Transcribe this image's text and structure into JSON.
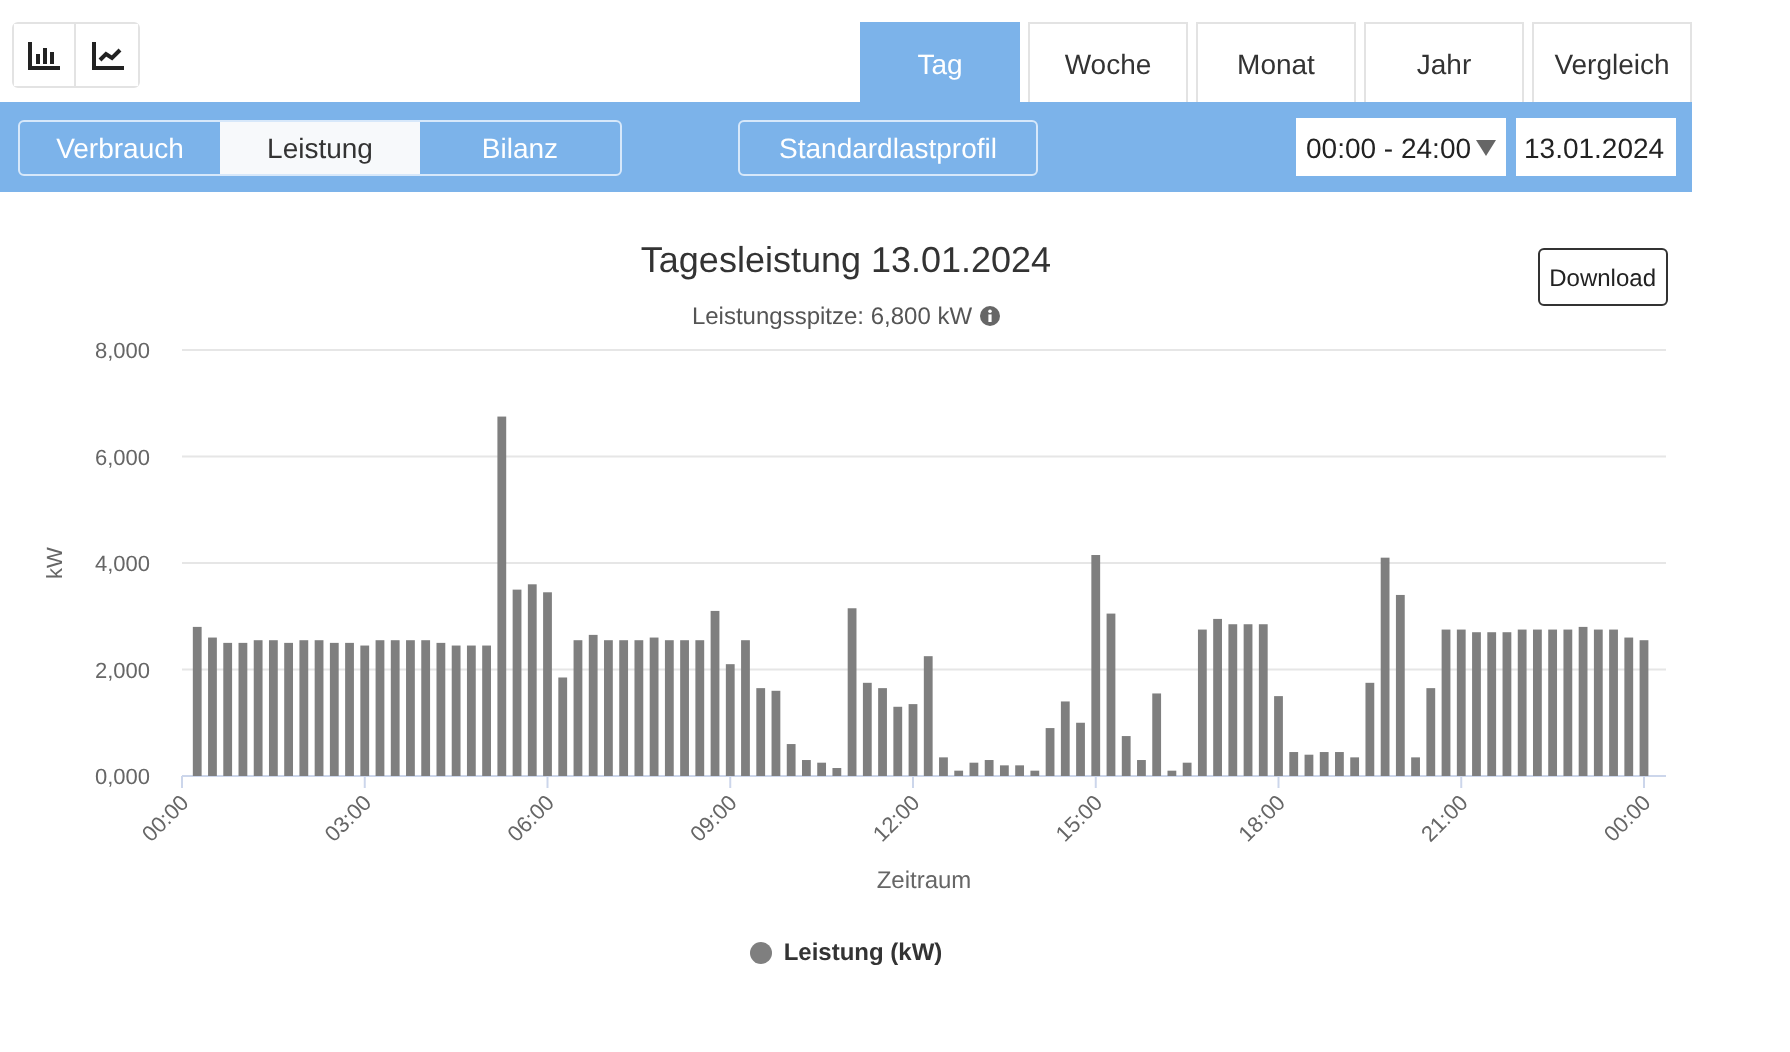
{
  "view_tabs": [
    {
      "label": "Tag",
      "selected": true
    },
    {
      "label": "Woche",
      "selected": false
    },
    {
      "label": "Monat",
      "selected": false
    },
    {
      "label": "Jahr",
      "selected": false
    },
    {
      "label": "Vergleich",
      "selected": false
    }
  ],
  "modes": [
    {
      "label": "Verbrauch",
      "selected": false
    },
    {
      "label": "Leistung",
      "selected": true
    },
    {
      "label": "Bilanz",
      "selected": false
    }
  ],
  "profile_button": "Standardlastprofil",
  "time_range": "00:00 - 24:00",
  "date": "13.01.2024",
  "chart": {
    "title": "Tagesleistung 13.01.2024",
    "subtitle": "Leistungsspitze: 6,800 kW",
    "download": "Download",
    "chart_data": {
      "type": "bar",
      "grid": "y",
      "xlabel": "Zeitraum",
      "ylabel": "kW",
      "xlim": [
        0,
        24
      ],
      "ylim": [
        0,
        8000
      ],
      "yticks": [
        {
          "value": 0,
          "label": "0,000"
        },
        {
          "value": 2000,
          "label": "2,000"
        },
        {
          "value": 4000,
          "label": "4,000"
        },
        {
          "value": 6000,
          "label": "6,000"
        },
        {
          "value": 8000,
          "label": "8,000"
        }
      ],
      "xticks": [
        {
          "value": 0,
          "label": "00:00"
        },
        {
          "value": 3,
          "label": "03:00"
        },
        {
          "value": 6,
          "label": "06:00"
        },
        {
          "value": 9,
          "label": "09:00"
        },
        {
          "value": 12,
          "label": "12:00"
        },
        {
          "value": 15,
          "label": "15:00"
        },
        {
          "value": 18,
          "label": "18:00"
        },
        {
          "value": 21,
          "label": "21:00"
        },
        {
          "value": 24,
          "label": "00:00"
        }
      ],
      "x": [
        0.25,
        0.5,
        0.75,
        1,
        1.25,
        1.5,
        1.75,
        2,
        2.25,
        2.5,
        2.75,
        3,
        3.25,
        3.5,
        3.75,
        4,
        4.25,
        4.5,
        4.75,
        5,
        5.25,
        5.5,
        5.75,
        6,
        6.25,
        6.5,
        6.75,
        7,
        7.25,
        7.5,
        7.75,
        8,
        8.25,
        8.5,
        8.75,
        9,
        9.25,
        9.5,
        9.75,
        10,
        10.25,
        10.5,
        10.75,
        11,
        11.25,
        11.5,
        11.75,
        12,
        12.25,
        12.5,
        12.75,
        13,
        13.25,
        13.5,
        13.75,
        14,
        14.25,
        14.5,
        14.75,
        15,
        15.25,
        15.5,
        15.75,
        16,
        16.25,
        16.5,
        16.75,
        17,
        17.25,
        17.5,
        17.75,
        18,
        18.25,
        18.5,
        18.75,
        19,
        19.25,
        19.5,
        19.75,
        20,
        20.25,
        20.5,
        20.75,
        21,
        21.25,
        21.5,
        21.75,
        22,
        22.25,
        22.5,
        22.75,
        23,
        23.25,
        23.5,
        23.75,
        24
      ],
      "series": [
        {
          "name": "Leistung (kW)",
          "color": "#7f7f7f",
          "values": [
            2800,
            2600,
            2500,
            2500,
            2550,
            2550,
            2500,
            2550,
            2550,
            2500,
            2500,
            2450,
            2550,
            2550,
            2550,
            2550,
            2500,
            2450,
            2450,
            2450,
            6750,
            3500,
            3600,
            3450,
            1850,
            2550,
            2650,
            2550,
            2550,
            2550,
            2600,
            2550,
            2550,
            2550,
            3100,
            2100,
            2550,
            1650,
            1600,
            600,
            300,
            250,
            150,
            3150,
            1750,
            1650,
            1300,
            1350,
            2250,
            350,
            100,
            250,
            300,
            200,
            200,
            100,
            900,
            1400,
            1000,
            4150,
            3050,
            750,
            300,
            1550,
            100,
            250,
            2750,
            2950,
            2850,
            2850,
            2850,
            1500,
            450,
            400,
            450,
            450,
            350,
            1750,
            4100,
            3400,
            350,
            1650,
            2750,
            2750,
            2700,
            2700,
            2700,
            2750,
            2750,
            2750,
            2750,
            2800,
            2750,
            2750,
            2600,
            2550
          ]
        }
      ]
    }
  }
}
